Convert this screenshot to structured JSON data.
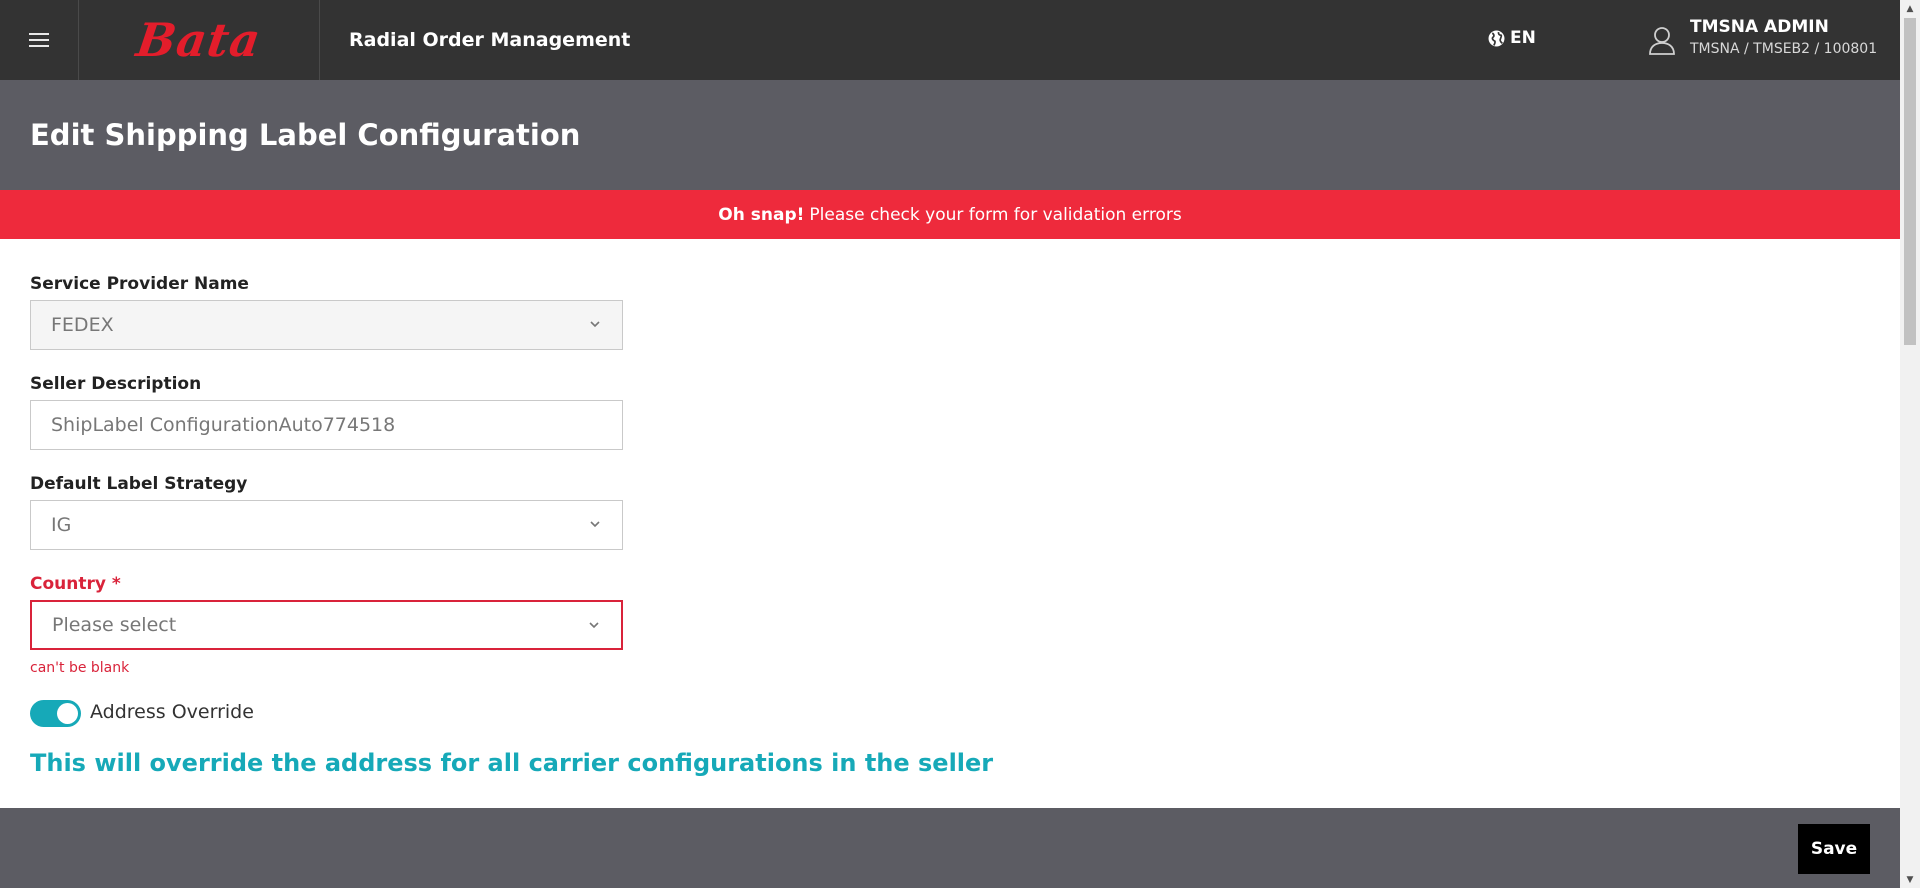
{
  "topbar": {
    "brand": "Bata",
    "app_title": "Radial Order Management",
    "language": "EN",
    "user_name": "TMSNA ADMIN",
    "user_context": "TMSNA / TMSEB2 / 100801"
  },
  "page": {
    "title": "Edit Shipping Label Configuration"
  },
  "alert": {
    "strong": "Oh snap!",
    "message": "Please check your form for validation errors"
  },
  "form": {
    "service_provider": {
      "label": "Service Provider Name",
      "value": "FEDEX"
    },
    "seller_description": {
      "label": "Seller Description",
      "value": "ShipLabel ConfigurationAuto774518"
    },
    "default_label_strategy": {
      "label": "Default Label Strategy",
      "value": "IG"
    },
    "country": {
      "label": "Country *",
      "placeholder": "Please select",
      "error": "can't be blank"
    },
    "address_override": {
      "label": "Address Override",
      "enabled": true
    },
    "override_notice": "This will override the address for all carrier configurations in the seller"
  },
  "footer": {
    "save_label": "Save"
  },
  "colors": {
    "topbar": "#333333",
    "header": "#5c5c63",
    "alert": "#ee2a3c",
    "brand_red": "#e31d2b",
    "accent_teal": "#16a9b8",
    "error_red": "#d9233a"
  },
  "icons": [
    "hamburger-menu-icon",
    "globe-icon",
    "user-icon",
    "chevron-down-icon"
  ]
}
